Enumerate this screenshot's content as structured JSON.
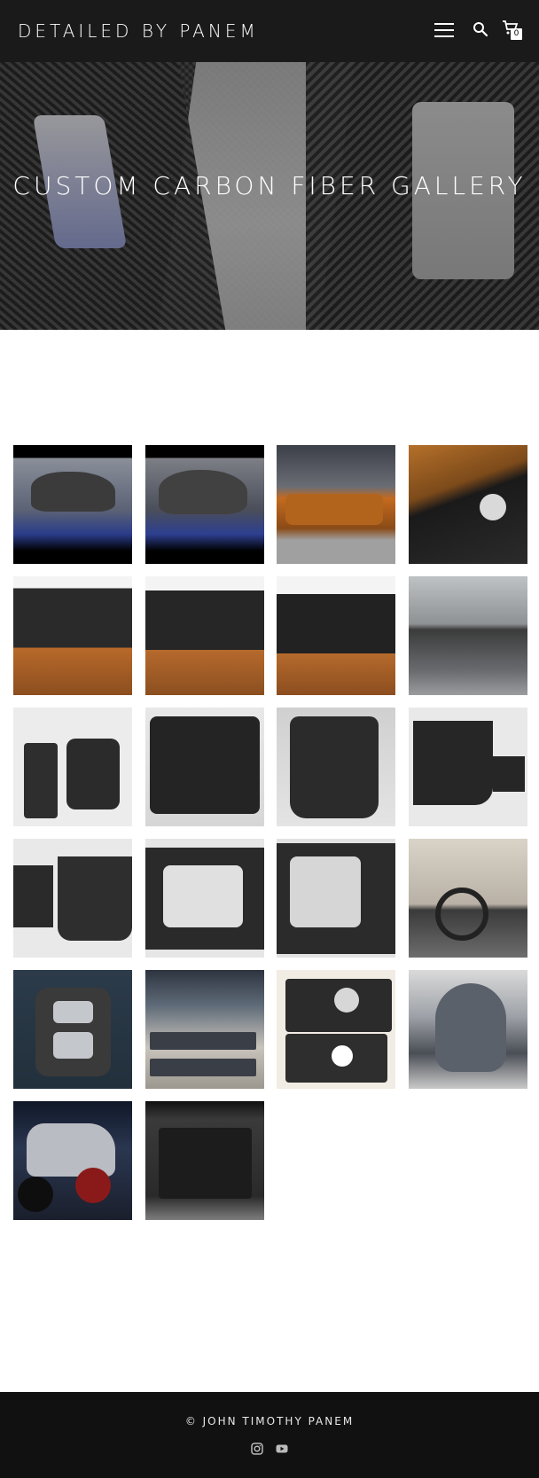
{
  "header": {
    "site_title": "DETAILED BY PANEM",
    "cart_count": "0"
  },
  "hero": {
    "title": "CUSTOM CARBON FIBER GALLERY"
  },
  "gallery": {
    "images": [
      {
        "subject": "motorcycle carbon seat cowl on blue frame"
      },
      {
        "subject": "carbon seat cowl close-up"
      },
      {
        "subject": "orange car front bumper in garage"
      },
      {
        "subject": "carbon panel with fuel cap on orange car"
      },
      {
        "subject": "carbon dash piece on wood table"
      },
      {
        "subject": "carbon dash piece side view"
      },
      {
        "subject": "carbon dash piece angled"
      },
      {
        "subject": "carbon console piece on concrete"
      },
      {
        "subject": "carbon switch panel and cover"
      },
      {
        "subject": "carbon cover plate"
      },
      {
        "subject": "carbon trim panel"
      },
      {
        "subject": "carbon triangular trim pieces"
      },
      {
        "subject": "carbon triangle trim pair"
      },
      {
        "subject": "carbon shifter surround"
      },
      {
        "subject": "carbon shifter surround angled"
      },
      {
        "subject": "classic car interior with steering wheel"
      },
      {
        "subject": "carbon switch bezel"
      },
      {
        "subject": "grey undertray parts on ground"
      },
      {
        "subject": "carbon fuel door panels"
      },
      {
        "subject": "classic car engine bay"
      },
      {
        "subject": "motorcycle with carbon parts"
      },
      {
        "subject": "car trunk carbon floor"
      }
    ]
  },
  "footer": {
    "copyright": "© JOHN TIMOTHY PANEM",
    "social": [
      "instagram-icon",
      "youtube-icon"
    ]
  },
  "colors": {
    "header_bg": "#1a1a1a",
    "footer_bg": "#111111",
    "text_light": "#ffffff"
  }
}
